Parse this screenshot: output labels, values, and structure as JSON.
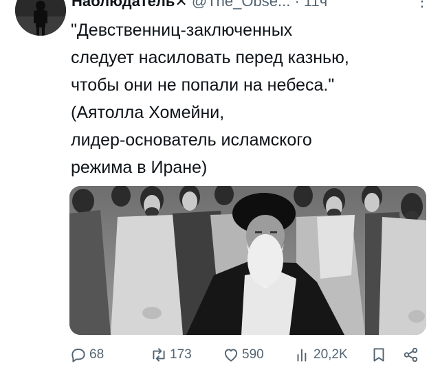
{
  "author": {
    "display_name": "Наблюдатель✕",
    "handle": "@The_Obse...",
    "separator": "·",
    "time": "11ч",
    "more_label": "⋮"
  },
  "tweet": {
    "text": "\"Девственниц-заключенных\nследует насиловать перед казнью,\nчтобы они не попали на небеса.\"\n(Аятолла Хомейни,\nлидер-основатель исламского\nрежима в Иране)"
  },
  "actions": {
    "replies": "68",
    "retweets": "173",
    "likes": "590",
    "views": "20,2K"
  },
  "icons": [
    "avatar",
    "reply-icon",
    "retweet-icon",
    "like-icon",
    "views-icon",
    "bookmark-icon",
    "share-icon",
    "more-icon"
  ],
  "colors": {
    "text": "#0f1419",
    "secondary": "#536471"
  }
}
